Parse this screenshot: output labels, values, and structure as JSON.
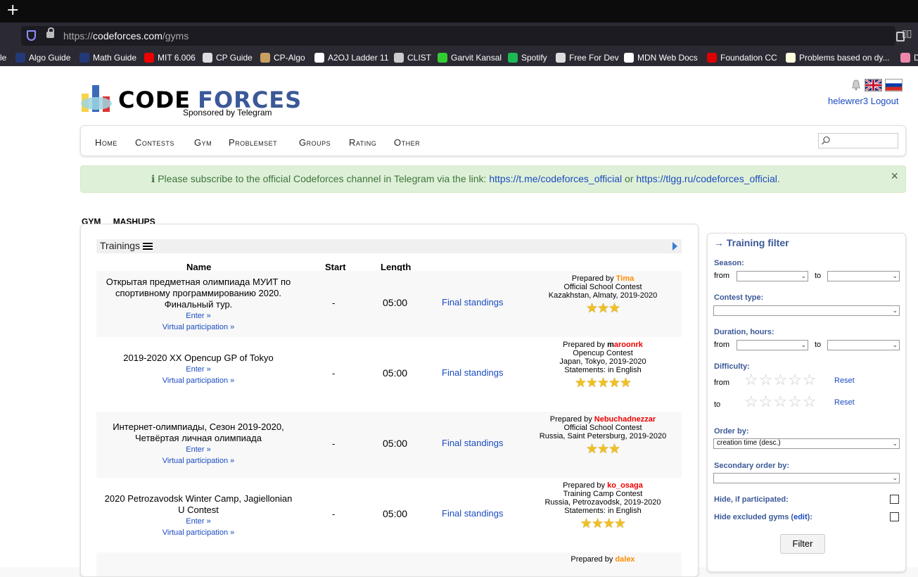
{
  "browser": {
    "new_tab": "+",
    "url_prefix": "https://",
    "url_domain": "codeforces.com",
    "url_path": "/gyms",
    "bookmarks": [
      {
        "label": "le",
        "color": "#2b2a33"
      },
      {
        "label": "Algo Guide",
        "color": "#223a7a"
      },
      {
        "label": "Math Guide",
        "color": "#223a7a"
      },
      {
        "label": "MIT 6.006",
        "color": "#e00"
      },
      {
        "label": "CP Guide",
        "color": "#ddd"
      },
      {
        "label": "CP-Algo",
        "color": "#c8a060"
      },
      {
        "label": "A2OJ Ladder 11",
        "color": "#fff"
      },
      {
        "label": "CLIST",
        "color": "#ccc"
      },
      {
        "label": "Garvit Kansal",
        "color": "#3c3"
      },
      {
        "label": "Spotify",
        "color": "#1db954"
      },
      {
        "label": "Free For Dev",
        "color": "#ddd"
      },
      {
        "label": "MDN Web Docs",
        "color": "#fff"
      },
      {
        "label": "Foundation CC",
        "color": "#d00"
      },
      {
        "label": "Problems based on dy...",
        "color": "#ffd"
      },
      {
        "label": "Di",
        "color": "#e8a"
      }
    ]
  },
  "header": {
    "logo_code": "CODE",
    "logo_forces": "FORCES",
    "sponsor": "Sponsored by Telegram",
    "username": "helewrer3",
    "logout": "Logout"
  },
  "nav": {
    "items": [
      "Home",
      "Contests",
      "Gym",
      "Problemset",
      "Groups",
      "Rating",
      "Other"
    ]
  },
  "alert": {
    "icon": "ℹ",
    "text": "Please subscribe to the official Codeforces channel in Telegram via the link:",
    "link1": "https://t.me/codeforces_official",
    "or": "or",
    "link2": "https://tlgg.ru/codeforces_official",
    "period": ".",
    "close": "×"
  },
  "subtabs": {
    "gym": "GYM",
    "mashups": "MASHUPS"
  },
  "trainings": {
    "title": "Trainings",
    "columns": {
      "name": "Name",
      "start": "Start",
      "length": "Length"
    },
    "enter": "Enter »",
    "virtual": "Virtual participation »",
    "rows": [
      {
        "name": "Открытая предметная олимпиада МУИТ по спортивному программированию 2020. Финальный тур.",
        "start": "-",
        "length": "05:00",
        "final": "Final standings",
        "prepared_by": "Prepared by",
        "author": "Tima",
        "author_color": "orange",
        "type": "Official School Contest",
        "location": "Kazakhstan, Almaty, 2019-2020",
        "statements": "",
        "stars": 3
      },
      {
        "name": "2019-2020 XX Opencup GP of Tokyo",
        "start": "-",
        "length": "05:00",
        "final": "Final standings",
        "prepared_by": "Prepared by",
        "author": "maroonrk",
        "author_color": "split",
        "type": "Opencup Contest",
        "location": "Japan, Tokyo, 2019-2020",
        "statements": "Statements: in English",
        "stars": 5
      },
      {
        "name": "Интернет-олимпиады, Сезон 2019-2020, Четвёртая личная олимпиада",
        "start": "-",
        "length": "05:00",
        "final": "Final standings",
        "prepared_by": "Prepared by",
        "author": "Nebuchadnezzar",
        "author_color": "red",
        "type": "Official School Contest",
        "location": "Russia, Saint Petersburg, 2019-2020",
        "statements": "",
        "stars": 3
      },
      {
        "name": "2020 Petrozavodsk Winter Camp, Jagiellonian U Contest",
        "start": "-",
        "length": "05:00",
        "final": "Final standings",
        "prepared_by": "Prepared by",
        "author": "ko_osaga",
        "author_color": "red",
        "type": "Training Camp Contest",
        "location": "Russia, Petrozavodsk, 2019-2020",
        "statements": "Statements: in English",
        "stars": 4
      },
      {
        "name": "",
        "prepared_by": "Prepared by",
        "author": "dalex",
        "author_color": "orange"
      }
    ]
  },
  "filter": {
    "title": "→ Training filter",
    "season": "Season:",
    "from": "from",
    "to": "to",
    "contest_type": "Contest type:",
    "duration": "Duration, hours:",
    "difficulty": "Difficulty:",
    "reset": "Reset",
    "order_by": "Order by:",
    "order_value": "creation time (desc.)",
    "secondary_order": "Secondary order by:",
    "hide_participated": "Hide, if participated:",
    "hide_excluded": "Hide excluded gyms (",
    "edit": "edit",
    "hide_excluded_end": "):",
    "button": "Filter"
  }
}
